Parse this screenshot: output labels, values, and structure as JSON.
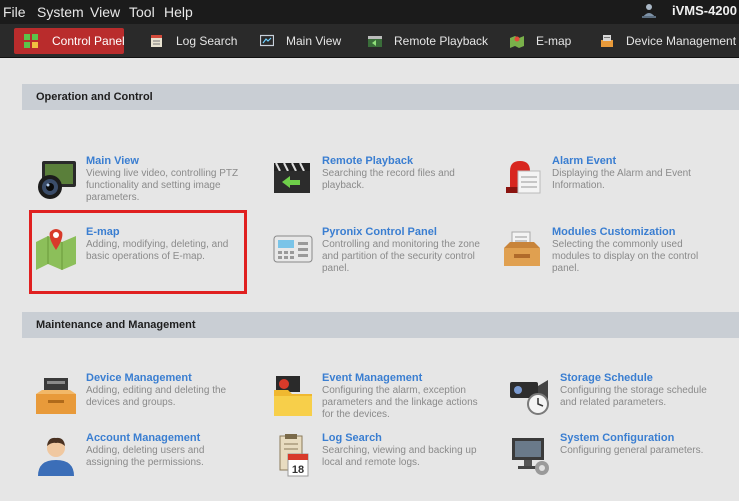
{
  "menubar": {
    "items": [
      "File",
      "System",
      "View",
      "Tool",
      "Help"
    ],
    "brand": "iVMS-4200"
  },
  "toolbar": {
    "tabs": [
      {
        "label": "Control Panel",
        "icon": "control-panel-icon",
        "active": true
      },
      {
        "label": "Log Search",
        "icon": "log-search-icon",
        "active": false
      },
      {
        "label": "Main View",
        "icon": "main-view-icon",
        "active": false
      },
      {
        "label": "Remote Playback",
        "icon": "remote-playback-icon",
        "active": false
      },
      {
        "label": "E-map",
        "icon": "emap-icon",
        "active": false
      },
      {
        "label": "Device Management",
        "icon": "device-management-icon",
        "active": false
      }
    ]
  },
  "sections": {
    "operation": {
      "title": "Operation and Control",
      "tiles": [
        {
          "title": "Main View",
          "desc": "Viewing live video, controlling PTZ functionality and setting image parameters.",
          "icon": "camera-lens-icon"
        },
        {
          "title": "Remote Playback",
          "desc": "Searching the record files and playback.",
          "icon": "playback-clapper-icon"
        },
        {
          "title": "Alarm Event",
          "desc": "Displaying the Alarm and Event Information.",
          "icon": "alarm-siren-icon"
        },
        {
          "title": "E-map",
          "desc": "Adding, modifying, deleting, and basic operations of E-map.",
          "icon": "map-pin-icon"
        },
        {
          "title": "Pyronix Control Panel",
          "desc": "Controlling and monitoring the zone and partition of the security control panel.",
          "icon": "keypad-panel-icon"
        },
        {
          "title": "Modules Customization",
          "desc": "Selecting the commonly used modules to display on the control panel.",
          "icon": "modules-box-icon"
        }
      ]
    },
    "maintenance": {
      "title": "Maintenance and Management",
      "tiles": [
        {
          "title": "Device Management",
          "desc": "Adding, editing and deleting the devices and groups.",
          "icon": "device-dvr-icon"
        },
        {
          "title": "Event Management",
          "desc": "Configuring the alarm, exception parameters and the linkage actions for the devices.",
          "icon": "event-folder-icon"
        },
        {
          "title": "Storage Schedule",
          "desc": "Configuring the storage schedule and related parameters.",
          "icon": "storage-camera-clock-icon"
        },
        {
          "title": "Account Management",
          "desc": "Adding, deleting users and assigning the permissions.",
          "icon": "user-account-icon"
        },
        {
          "title": "Log Search",
          "desc": "Searching, viewing and backing up local and remote logs.",
          "icon": "log-calendar-icon"
        },
        {
          "title": "System Configuration",
          "desc": "Configuring general parameters.",
          "icon": "monitor-gear-icon"
        }
      ]
    }
  },
  "colors": {
    "accent_active_tab": "#b92c2c",
    "tile_title": "#3a7ed1",
    "highlight_box": "#e02020",
    "section_header_bg": "#c9ced4"
  }
}
